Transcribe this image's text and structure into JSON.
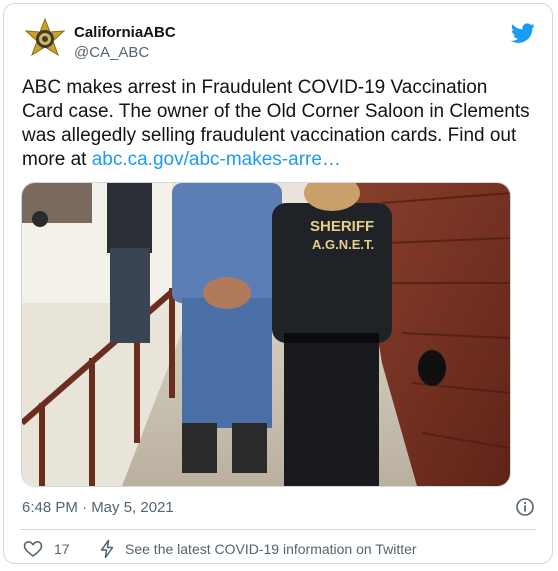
{
  "author": {
    "display_name": "CaliforniaABC",
    "handle": "@CA_ABC",
    "avatar_icon": "sheriff-star-badge-icon"
  },
  "platform_icon": "twitter-bird-icon",
  "tweet": {
    "text": "ABC makes arrest in Fraudulent COVID-19 Vaccination Card case. The owner of the Old Corner Saloon in Clements was allegedly selling fraudulent vaccination cards. Find out more at ",
    "link_text": "abc.ca.gov/abc-makes-arre…",
    "media": {
      "vest_text_line1": "SHERIFF",
      "vest_text_line2": "A.G.N.E.T."
    }
  },
  "meta": {
    "timestamp": "6:48 PM · May 5, 2021",
    "info_icon": "info-circle-icon"
  },
  "actions": {
    "like_count": "17",
    "like_icon": "heart-outline-icon",
    "covid_info_icon": "lightning-bolt-icon",
    "covid_info_text": "See the latest COVID-19 information on Twitter"
  },
  "colors": {
    "link": "#1d9bf0",
    "twitter_blue": "#1d9bf0",
    "text_primary": "#0f1419",
    "text_secondary": "#536471",
    "border": "#cfd9de",
    "badge_gold": "#c9a227"
  }
}
